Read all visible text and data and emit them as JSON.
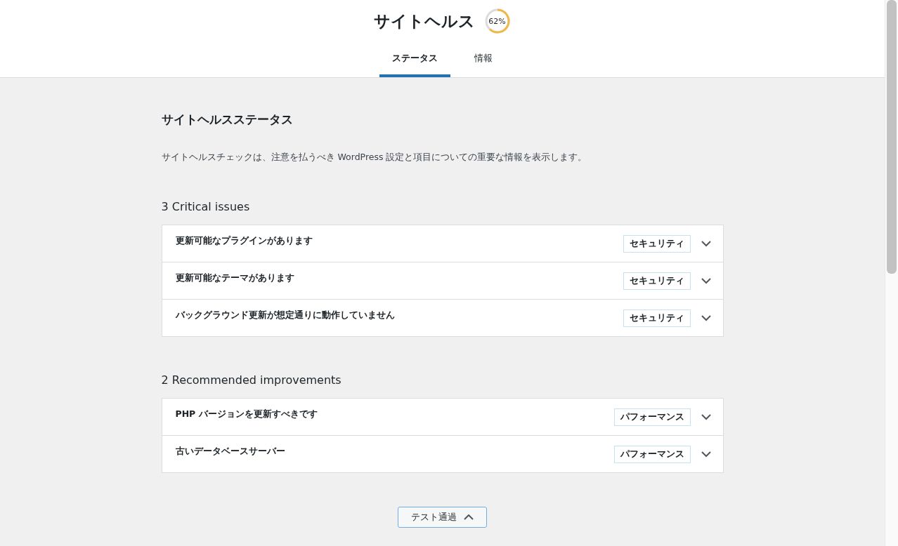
{
  "header": {
    "title": "サイトヘルス",
    "score": {
      "label": "62%",
      "level": 0.62
    }
  },
  "tabs": [
    {
      "label": "ステータス",
      "selected": true
    },
    {
      "label": "情報",
      "selected": false
    }
  ],
  "status": {
    "heading": "サイトヘルスステータス",
    "description": "サイトヘルスチェックは、注意を払うべき WordPress 設定と項目についての重要な情報を表示します。"
  },
  "groups": [
    {
      "title": "3 Critical issues",
      "items": [
        {
          "label": "更新可能なプラグインがあります",
          "badge": "セキュリティ",
          "expanded": false
        },
        {
          "label": "更新可能なテーマがあります",
          "badge": "セキュリティ",
          "expanded": false
        },
        {
          "label": "バックグラウンド更新が想定通りに動作していません",
          "badge": "セキュリティ",
          "expanded": false
        }
      ]
    },
    {
      "title": "2 Recommended improvements",
      "items": [
        {
          "label": "PHP バージョンを更新すべきです",
          "badge": "パフォーマンス",
          "expanded": false
        },
        {
          "label": "古いデータベースサーバー",
          "badge": "パフォーマンス",
          "expanded": false
        }
      ]
    }
  ],
  "passed_button": {
    "label": "テスト通過",
    "expanded": true
  }
}
